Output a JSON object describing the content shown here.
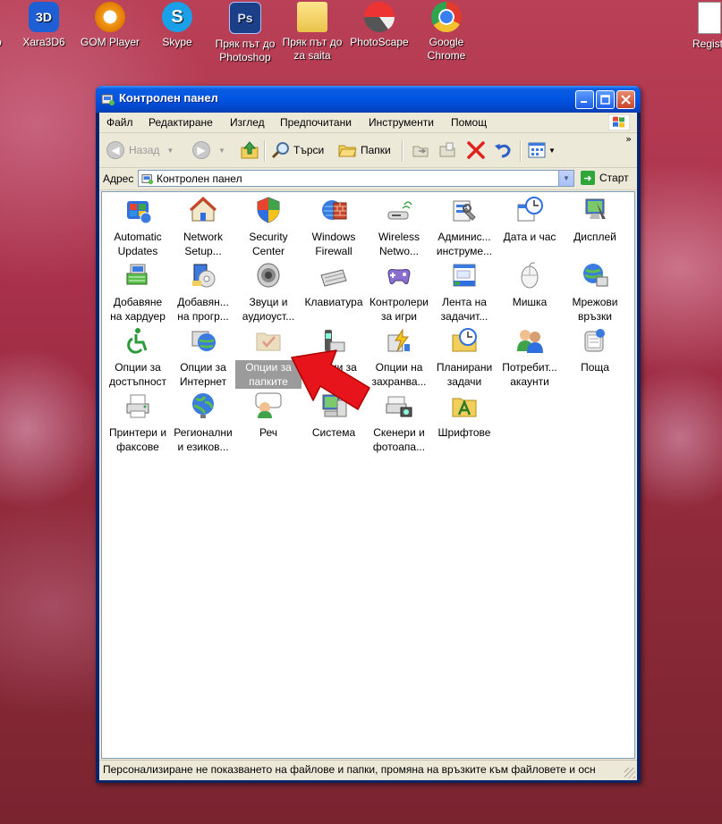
{
  "desktop": {
    "icons": [
      {
        "label": "до",
        "icon": "shortcut-icon"
      },
      {
        "label": "Xara3D6",
        "icon": "xara3d-icon"
      },
      {
        "label": "GOM Player",
        "icon": "gom-player-icon"
      },
      {
        "label": "Skype",
        "icon": "skype-icon"
      },
      {
        "label": "Пряк път до Photoshop",
        "icon": "photoshop-icon"
      },
      {
        "label": "Пряк път до za saita",
        "icon": "folder-icon"
      },
      {
        "label": "PhotoScape",
        "icon": "photoscape-icon"
      },
      {
        "label": "Google Chrome",
        "icon": "chrome-icon"
      },
      {
        "label": "Registr",
        "icon": "document-icon"
      }
    ]
  },
  "window": {
    "title": "Контролен панел",
    "menu": [
      "Файл",
      "Редактиране",
      "Изглед",
      "Предпочитани",
      "Инструменти",
      "Помощ"
    ],
    "toolbar": {
      "back": "Назад",
      "search": "Търси",
      "folders": "Папки"
    },
    "address": {
      "label": "Адрес",
      "value": "Контролен панел",
      "go": "Старт"
    },
    "items": [
      {
        "line1": "Automatic",
        "line2": "Updates",
        "icon": "windows-update-icon"
      },
      {
        "line1": "Network",
        "line2": "Setup...",
        "icon": "network-setup-icon"
      },
      {
        "line1": "Security",
        "line2": "Center",
        "icon": "shield-icon"
      },
      {
        "line1": "Windows",
        "line2": "Firewall",
        "icon": "firewall-icon"
      },
      {
        "line1": "Wireless",
        "line2": "Netwo...",
        "icon": "wireless-icon"
      },
      {
        "line1": "Админис...",
        "line2": "инструме...",
        "icon": "admin-tools-icon"
      },
      {
        "line1": "Дата и час",
        "line2": "",
        "icon": "clock-icon"
      },
      {
        "line1": "Дисплей",
        "line2": "",
        "icon": "display-icon"
      },
      {
        "line1": "Добавяне",
        "line2": "на хардуер",
        "icon": "hardware-icon"
      },
      {
        "line1": "Добавян...",
        "line2": "на прогр...",
        "icon": "add-programs-icon"
      },
      {
        "line1": "Звуци и",
        "line2": "аудиоуст...",
        "icon": "speaker-icon"
      },
      {
        "line1": "Клавиатура",
        "line2": "",
        "icon": "keyboard-icon"
      },
      {
        "line1": "Контролери",
        "line2": "за игри",
        "icon": "gamepad-icon"
      },
      {
        "line1": "Лента на",
        "line2": "задачит...",
        "icon": "taskbar-icon"
      },
      {
        "line1": "Мишка",
        "line2": "",
        "icon": "mouse-icon"
      },
      {
        "line1": "Мрежови",
        "line2": "връзки",
        "icon": "network-connections-icon"
      },
      {
        "line1": "Опции за",
        "line2": "достъпност",
        "icon": "accessibility-icon"
      },
      {
        "line1": "Опции за",
        "line2": "Интернет",
        "icon": "internet-options-icon"
      },
      {
        "line1": "Опции за",
        "line2": "папките",
        "icon": "folder-options-icon"
      },
      {
        "line1": "Опции за",
        "line2": "",
        "icon": "phone-modem-icon"
      },
      {
        "line1": "Опции на",
        "line2": "захранва...",
        "icon": "power-icon"
      },
      {
        "line1": "Планирани",
        "line2": "задачи",
        "icon": "scheduled-tasks-icon"
      },
      {
        "line1": "Потребит...",
        "line2": "акаунти",
        "icon": "user-accounts-icon"
      },
      {
        "line1": "Поща",
        "line2": "",
        "icon": "mail-icon"
      },
      {
        "line1": "Принтери и",
        "line2": "факсове",
        "icon": "printer-icon"
      },
      {
        "line1": "Регионални",
        "line2": "и езиков...",
        "icon": "globe-icon"
      },
      {
        "line1": "Реч",
        "line2": "",
        "icon": "speech-icon"
      },
      {
        "line1": "Система",
        "line2": "",
        "icon": "system-icon"
      },
      {
        "line1": "Скенери и",
        "line2": "фотоапа...",
        "icon": "scanner-icon"
      },
      {
        "line1": "Шрифтове",
        "line2": "",
        "icon": "fonts-icon"
      }
    ],
    "selected_item": "Опции за папките",
    "status": "Персонализиране не показването на файлове и папки, промяна на връзките към файловете и осн"
  },
  "colors": {
    "desktop": "#a8304a",
    "titlebar": "#0054e3",
    "selection": "#9b9b9b",
    "arrow": "#e8141c"
  }
}
